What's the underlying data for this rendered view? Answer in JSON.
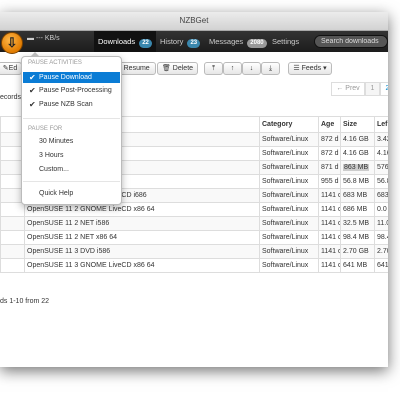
{
  "window": {
    "title": "NZBGet"
  },
  "navbar": {
    "logo_glyph": "⇩",
    "speed": "--- KB/s",
    "tabs": [
      {
        "label": "Downloads",
        "badge": "22"
      },
      {
        "label": "History",
        "badge": "23"
      },
      {
        "label": "Messages",
        "badge": "2080"
      },
      {
        "label": "Settings"
      }
    ],
    "search_placeholder": "Search downloads"
  },
  "toolbar": {
    "edit_label": "Ed",
    "resume_label": "Resume",
    "delete_label": "Delete",
    "move_top": "⤒",
    "move_up": "↑",
    "move_down": "↓",
    "move_bottom": "⤓",
    "feeds_label": "Feeds",
    "records_label": "ecords"
  },
  "pagination": {
    "prev": "← Prev",
    "pages": [
      "1",
      "2",
      "3"
    ]
  },
  "table": {
    "headers": [
      "Category",
      "Age",
      "Size",
      "Lef"
    ],
    "rows": [
      {
        "name": "",
        "category": "Software/Linux",
        "age": "872 d",
        "size": "4.16 GB",
        "left": "3.42 GB"
      },
      {
        "name": "",
        "category": "Software/Linux",
        "age": "872 d",
        "size": "4.16 GB",
        "left": "4.16 GB"
      },
      {
        "name": "",
        "priority": "gh priority",
        "category": "Software/Linux",
        "age": "871 d",
        "size": "863 MB",
        "left": "576 MB"
      },
      {
        "name": "i386 DVD",
        "category": "Software/Linux",
        "age": "955 d",
        "size": "56.8 MB",
        "left": "56.8 MB"
      },
      {
        "name": "OpenSUSE 11 2 GNOME LiveCD i686",
        "category": "Software/Linux",
        "age": "1141 d",
        "size": "683 MB",
        "left": "683 MB"
      },
      {
        "name": "OpenSUSE 11 2 GNOME LiveCD x86 64",
        "category": "Software/Linux",
        "age": "1141 d",
        "size": "686 MB",
        "left": "0.0 MB"
      },
      {
        "name": "OpenSUSE 11 2 NET i586",
        "category": "Software/Linux",
        "age": "1141 d",
        "size": "32.5 MB",
        "left": "11.0 MB"
      },
      {
        "name": "OpenSUSE 11 2 NET x86 64",
        "category": "Software/Linux",
        "age": "1141 d",
        "size": "98.4 MB",
        "left": "98.4 MB"
      },
      {
        "name": "OpenSUSE 11 3 DVD i586",
        "category": "Software/Linux",
        "age": "1141 d",
        "size": "2.70 GB",
        "left": "2.70 GB"
      },
      {
        "name": "OpenSUSE 11 3 GNOME LiveCD x86 64",
        "category": "Software/Linux",
        "age": "1141 d",
        "size": "641 MB",
        "left": "641 MB"
      }
    ],
    "footer": "ds 1-10 from 22"
  },
  "menu": {
    "header_activities": "PAUSE ACTIVITIES",
    "pause_download": "Pause Download",
    "pause_post": "Pause Post-Processing",
    "pause_scan": "Pause NZB Scan",
    "header_pause_for": "PAUSE FOR",
    "minutes30": "30 Minutes",
    "hours3": "3 Hours",
    "custom": "Custom...",
    "quick_help": "Quick Help",
    "check": "✔"
  }
}
